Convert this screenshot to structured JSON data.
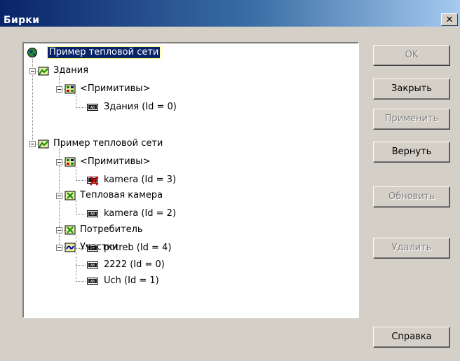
{
  "window": {
    "title": "Бирки",
    "close_glyph": "✕"
  },
  "tree": {
    "root": "Пример тепловой сети",
    "group_buildings": "Здания",
    "primitives_1": "<Примитивы>",
    "buildings_tag": "Здания (Id = 0)",
    "group_network": "Пример тепловой сети",
    "primitives_2": "<Примитивы>",
    "kamera_tag_3": "kamera (Id = 3)",
    "group_chamber": "Тепловая камера",
    "kamera_tag_2": "kamera (Id = 2)",
    "group_consumer": "Потребитель",
    "potreb_tag": "potreb (Id = 4)",
    "group_sections": "Участки",
    "section_tag_2222": "2222 (Id = 0)",
    "section_tag_uch": "Uch (Id = 1)"
  },
  "buttons": {
    "ok": "OK",
    "close": "Закрыть",
    "apply": "Применить",
    "revert": "Вернуть",
    "refresh": "Обновить",
    "delete": "Удалить",
    "help": "Справка"
  },
  "icons": {
    "root": "globe-icon",
    "group": "layer-folder-icon",
    "primitives": "primitives-icon",
    "chamber": "chamber-icon",
    "sections": "pipe-section-icon",
    "tag": "tag-label-icon",
    "tag_error": "tag-error-icon"
  },
  "colors": {
    "title_start": "#0a246a",
    "title_end": "#a6caf0",
    "dialog_bg": "#d4d0c8",
    "selection": "#0a246a"
  }
}
